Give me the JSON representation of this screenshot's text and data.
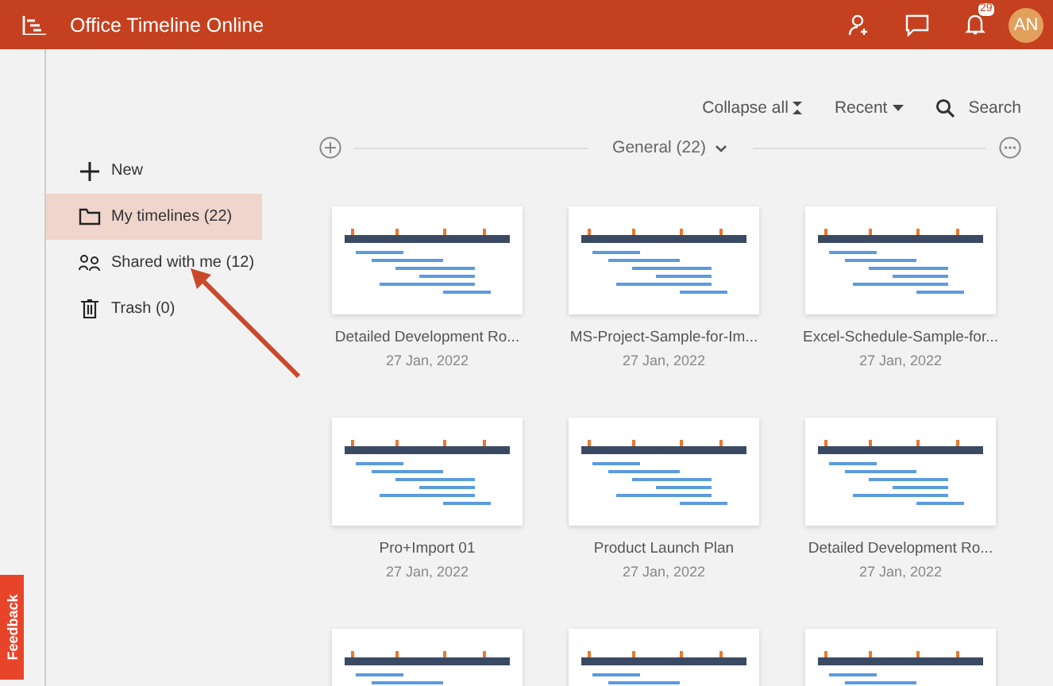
{
  "header": {
    "title": "Office Timeline Online",
    "notification_count": "29",
    "avatar": "AN"
  },
  "toolbar": {
    "collapse": "Collapse all",
    "sort": "Recent",
    "search": "Search"
  },
  "sidebar": {
    "items": [
      {
        "kind": "new",
        "label": "New",
        "selected": false
      },
      {
        "kind": "folder",
        "label": "My timelines (22)",
        "selected": true
      },
      {
        "kind": "shared",
        "label": "Shared with me (12)",
        "selected": false
      },
      {
        "kind": "trash",
        "label": "Trash (0)",
        "selected": false
      }
    ]
  },
  "group": {
    "label": "General (22)"
  },
  "cards": [
    {
      "title": "Detailed Development Ro...",
      "date": "27 Jan, 2022",
      "thumbnail": true
    },
    {
      "title": "MS-Project-Sample-for-Im...",
      "date": "27 Jan, 2022",
      "thumbnail": true
    },
    {
      "title": "Excel-Schedule-Sample-for...",
      "date": "27 Jan, 2022",
      "thumbnail": true
    },
    {
      "title": "Pro+Import 01",
      "date": "27 Jan, 2022",
      "thumbnail": true
    },
    {
      "title": "Product Launch Plan",
      "date": "27 Jan, 2022",
      "thumbnail": true
    },
    {
      "title": "Detailed Development Ro...",
      "date": "27 Jan, 2022",
      "thumbnail": true
    },
    {
      "thumbnail": true
    },
    {
      "thumbnail": true
    },
    {
      "thumbnail": true
    }
  ],
  "feedback": "Feedback"
}
